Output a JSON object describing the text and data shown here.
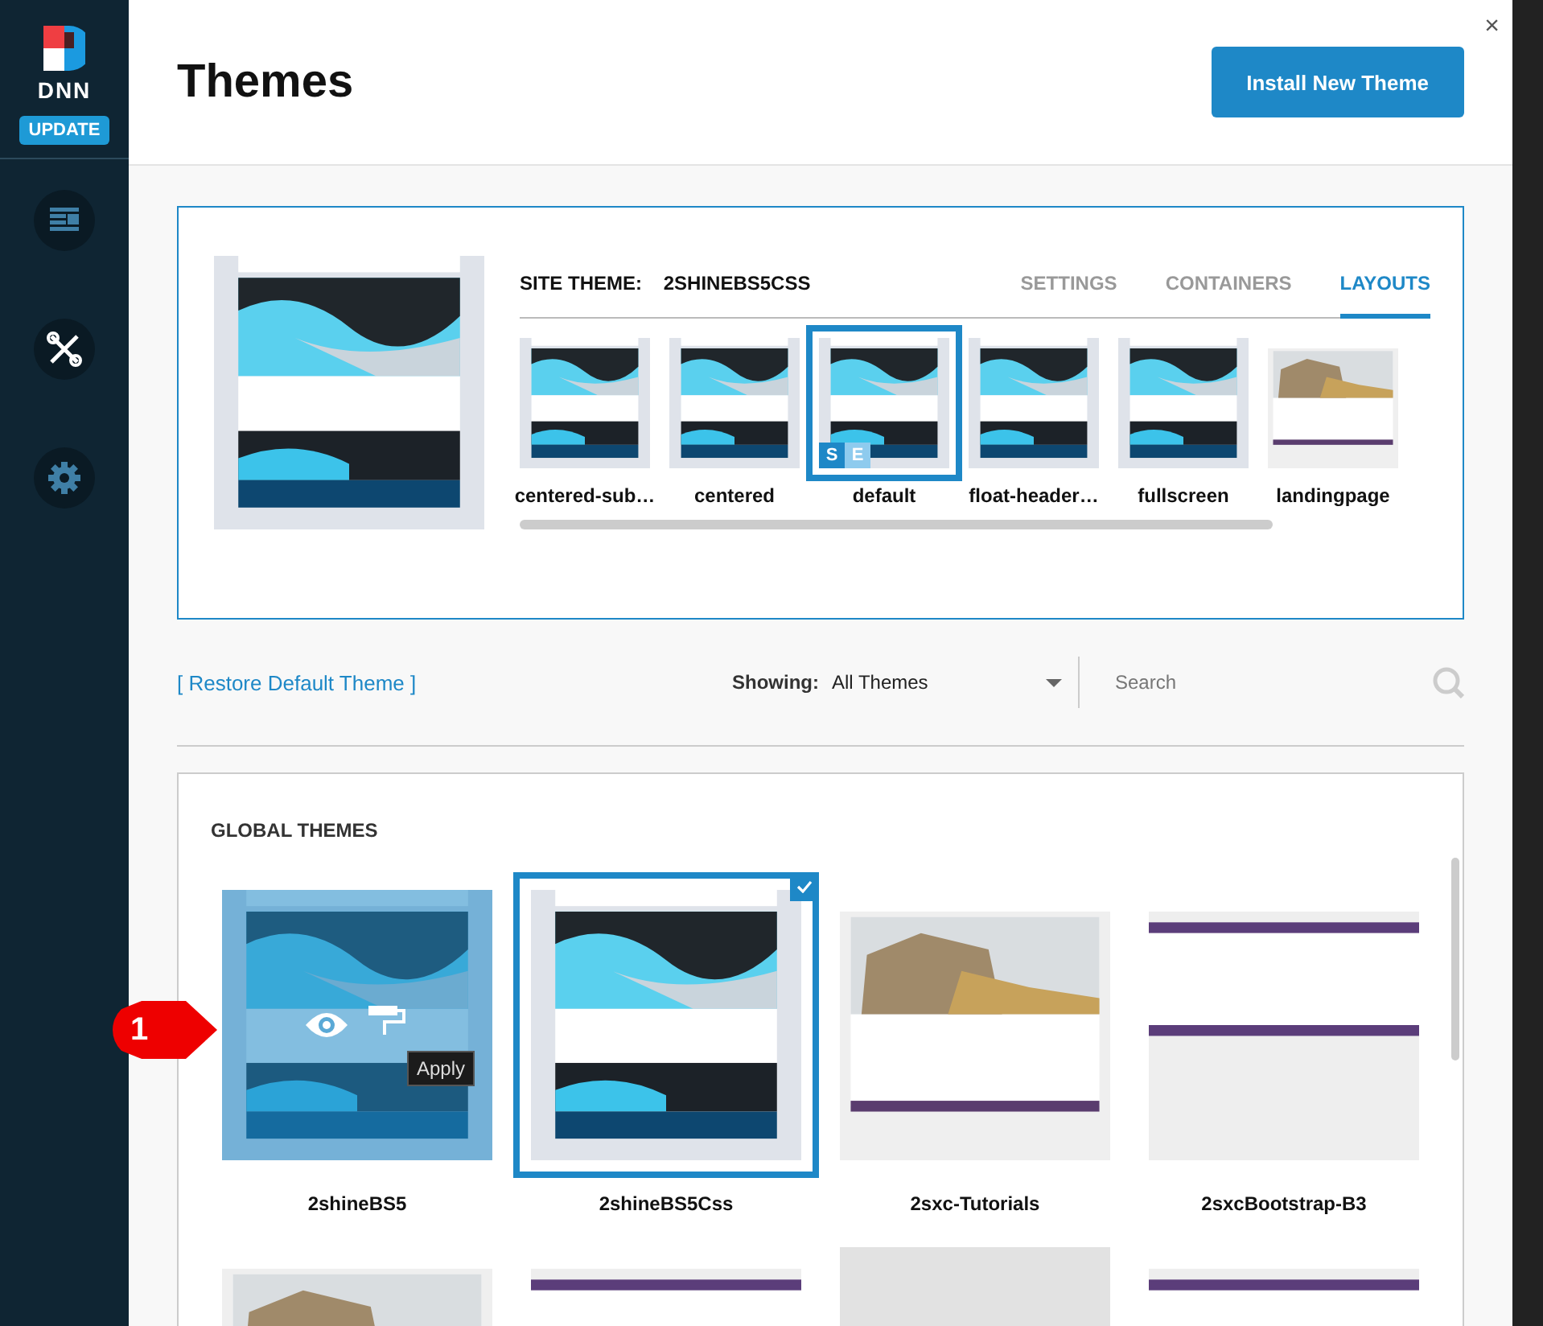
{
  "sidebar": {
    "logo": "DNN",
    "update_button": "UPDATE",
    "nav": [
      {
        "kind": "content"
      },
      {
        "kind": "tools"
      },
      {
        "kind": "settings"
      }
    ]
  },
  "header": {
    "title": "Themes",
    "install_button": "Install New Theme",
    "close": "×"
  },
  "site_theme": {
    "label": "SITE THEME:",
    "name": "2SHINEBS5CSS",
    "tabs": [
      {
        "label": "SETTINGS",
        "selected": false
      },
      {
        "label": "CONTAINERS",
        "selected": false
      },
      {
        "label": "LAYOUTS",
        "selected": true
      }
    ],
    "layouts": [
      {
        "label": "centered-sub…",
        "selected": false
      },
      {
        "label": "centered",
        "selected": false
      },
      {
        "label": "default",
        "selected": true,
        "badges": [
          {
            "text": "S",
            "color": "#1e88c7"
          },
          {
            "text": "E",
            "color": "#8ecbee"
          }
        ]
      },
      {
        "label": "float-header…",
        "selected": false
      },
      {
        "label": "fullscreen",
        "selected": false
      },
      {
        "label": "landingpage",
        "selected": false
      }
    ]
  },
  "filter": {
    "restore_link": "[ Restore Default Theme ]",
    "showing_label": "Showing:",
    "showing_value": "All Themes",
    "search": {
      "placeholder": "Search"
    }
  },
  "global_themes": {
    "title": "GLOBAL THEMES",
    "themes": [
      {
        "name": "2shineBS5",
        "selected": false,
        "hovered": true,
        "tooltip": "Apply"
      },
      {
        "name": "2shineBS5Css",
        "selected": true,
        "hovered": false
      },
      {
        "name": "2sxc-Tutorials",
        "selected": false,
        "hovered": false
      },
      {
        "name": "2sxcBootstrap-B3",
        "selected": false,
        "hovered": false
      },
      {
        "selected": false,
        "hovered": false
      },
      {
        "selected": false,
        "hovered": false
      },
      {
        "selected": false,
        "hovered": false
      },
      {
        "selected": false,
        "hovered": false
      }
    ]
  },
  "callout": "1"
}
